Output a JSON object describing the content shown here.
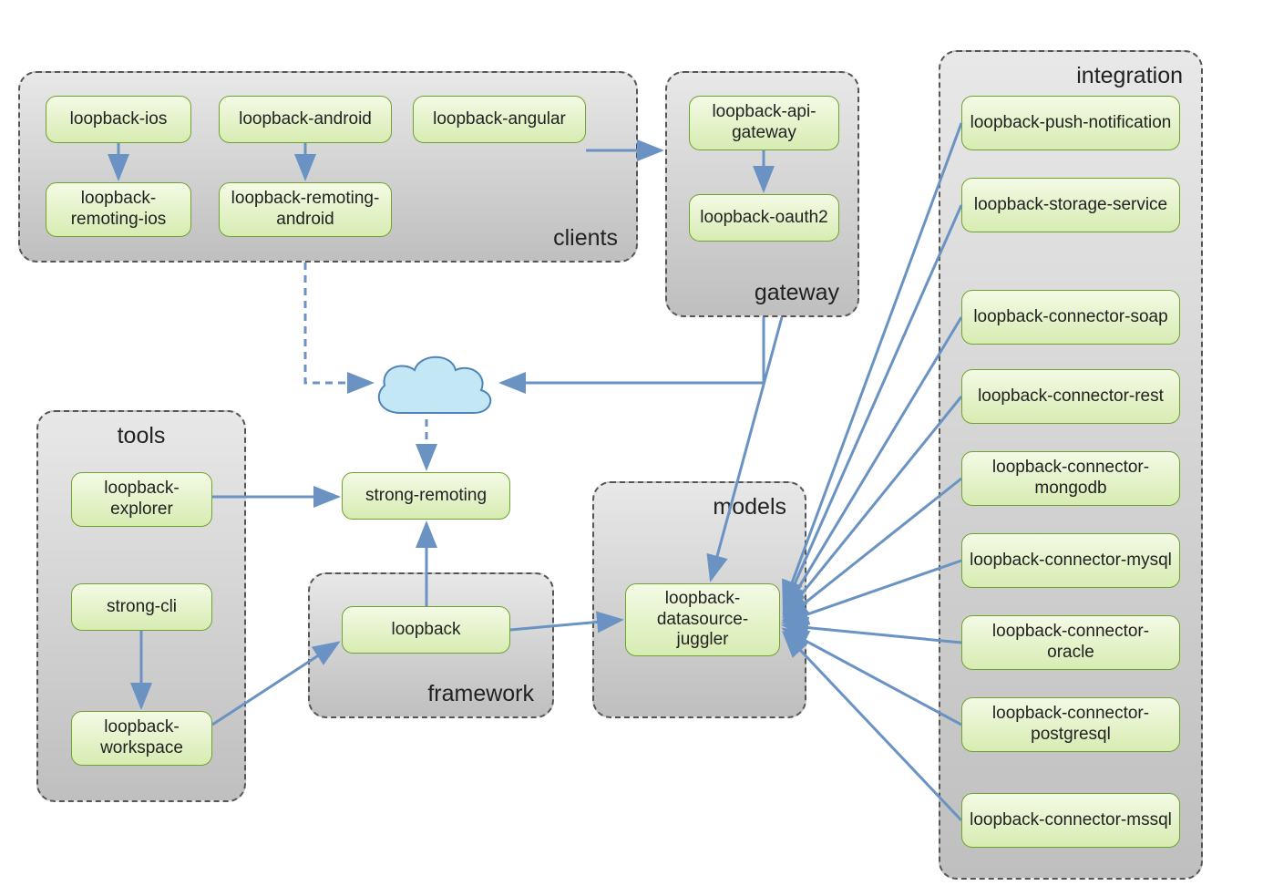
{
  "groups": {
    "clients": {
      "label": "clients"
    },
    "gateway": {
      "label": "gateway"
    },
    "integration": {
      "label": "integration"
    },
    "tools": {
      "label": "tools"
    },
    "framework": {
      "label": "framework"
    },
    "models": {
      "label": "models"
    }
  },
  "nodes": {
    "loopback_ios": "loopback-ios",
    "loopback_android": "loopback-android",
    "loopback_angular": "loopback-angular",
    "loopback_remoting_ios": "loopback-remoting-ios",
    "loopback_remoting_android": "loopback-remoting-android",
    "loopback_api_gateway": "loopback-api-gateway",
    "loopback_oauth2": "loopback-oauth2",
    "loopback_push_notification": "loopback-push-notification",
    "loopback_storage_service": "loopback-storage-service",
    "loopback_connector_soap": "loopback-connector-soap",
    "loopback_connector_rest": "loopback-connector-rest",
    "loopback_connector_mongodb": "loopback-connector-mongodb",
    "loopback_connector_mysql": "loopback-connector-mysql",
    "loopback_connector_oracle": "loopback-connector-oracle",
    "loopback_connector_postgresql": "loopback-connector-postgresql",
    "loopback_connector_mssql": "loopback-connector-mssql",
    "loopback_explorer": "loopback-explorer",
    "strong_cli": "strong-cli",
    "loopback_workspace": "loopback-workspace",
    "strong_remoting": "strong-remoting",
    "loopback": "loopback",
    "loopback_datasource_juggler": "loopback-datasource-juggler"
  },
  "colors": {
    "arrow": "#6a93c3",
    "cloud_fill": "#c3e7f5",
    "cloud_stroke": "#4f84b6"
  }
}
